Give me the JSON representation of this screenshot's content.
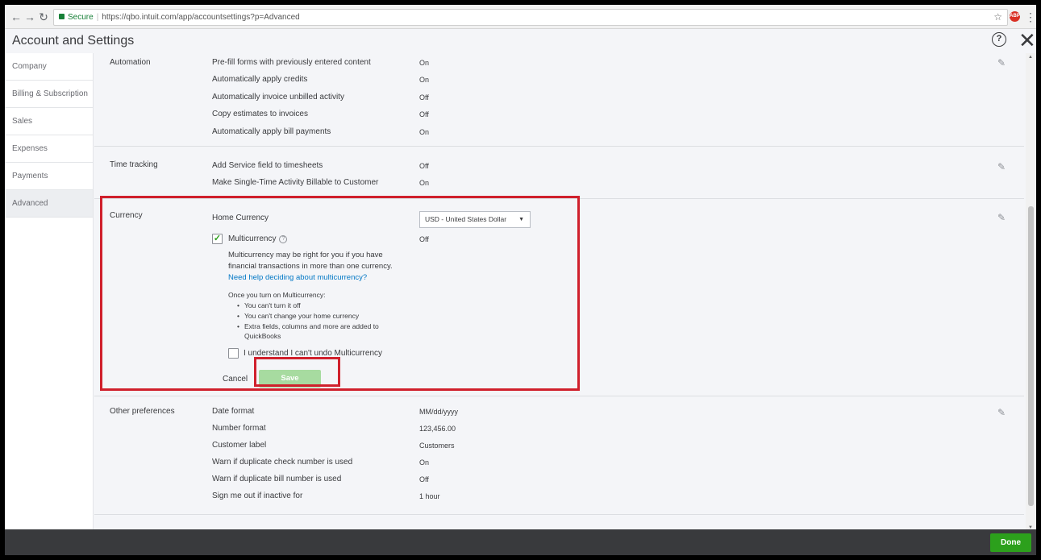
{
  "browser": {
    "back": "←",
    "forward": "→",
    "reload": "↻",
    "secure_label": "Secure",
    "url": "https://qbo.intuit.com/app/accountsettings?p=Advanced",
    "star": "☆",
    "ext_label": "ABP",
    "menu": "⋮"
  },
  "header": {
    "title": "Account and Settings",
    "help": "?",
    "close": "✕"
  },
  "sidebar": {
    "items": [
      {
        "label": "Company"
      },
      {
        "label": "Billing & Subscription"
      },
      {
        "label": "Sales"
      },
      {
        "label": "Expenses"
      },
      {
        "label": "Payments"
      },
      {
        "label": "Advanced"
      }
    ]
  },
  "automation": {
    "label": "Automation",
    "rows": [
      {
        "name": "Pre-fill forms with previously entered content",
        "value": "On"
      },
      {
        "name": "Automatically apply credits",
        "value": "On"
      },
      {
        "name": "Automatically invoice unbilled activity",
        "value": "Off"
      },
      {
        "name": "Copy estimates to invoices",
        "value": "Off"
      },
      {
        "name": "Automatically apply bill payments",
        "value": "On"
      }
    ]
  },
  "time_tracking": {
    "label": "Time tracking",
    "rows": [
      {
        "name": "Add Service field to timesheets",
        "value": "Off"
      },
      {
        "name": "Make Single-Time Activity Billable to Customer",
        "value": "On"
      }
    ]
  },
  "currency": {
    "label": "Currency",
    "home_currency_label": "Home Currency",
    "home_currency_value": "USD - United States Dollar",
    "multicurrency_label": "Multicurrency",
    "multicurrency_value": "Off",
    "desc_line1": "Multicurrency may be right for you if you have",
    "desc_line2": "financial transactions in more than one currency.",
    "help_link": "Need help deciding about multicurrency?",
    "once_label": "Once you turn on Multicurrency:",
    "bullets": [
      "You can't turn it off",
      "You can't change your home currency",
      "Extra fields, columns and more are added to"
    ],
    "bullet_cont": "QuickBooks",
    "understand_label": "I understand I can't undo Multicurrency",
    "cancel": "Cancel",
    "save": "Save"
  },
  "other": {
    "label": "Other preferences",
    "rows": [
      {
        "name": "Date format",
        "value": "MM/dd/yyyy"
      },
      {
        "name": "Number format",
        "value": "123,456.00"
      },
      {
        "name": "Customer label",
        "value": "Customers"
      },
      {
        "name": "Warn if duplicate check number is used",
        "value": "On"
      },
      {
        "name": "Warn if duplicate bill number is used",
        "value": "Off"
      },
      {
        "name": "Sign me out if inactive for",
        "value": "1 hour"
      }
    ]
  },
  "footer": {
    "done": "Done"
  },
  "colors": {
    "accent_green": "#2ca01c",
    "link_blue": "#0077c5",
    "highlight_red": "#d0202c"
  },
  "icons": {
    "pencil": "✎"
  }
}
